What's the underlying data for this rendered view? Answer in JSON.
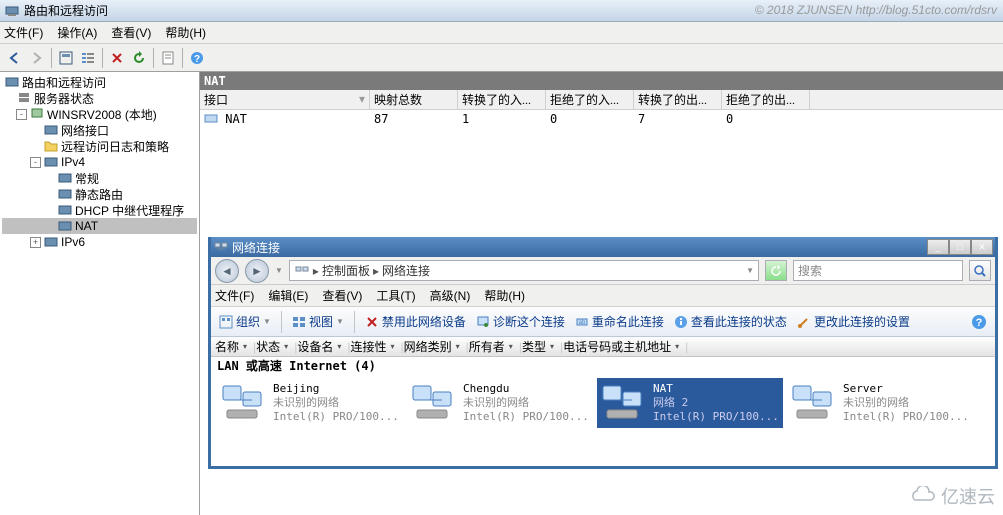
{
  "title_bar": {
    "title": "路由和远程访问"
  },
  "watermark": "© 2018 ZJUNSEN http://blog.51cto.com/rdsrv",
  "menu": {
    "file": "文件(F)",
    "action": "操作(A)",
    "view": "查看(V)",
    "help": "帮助(H)"
  },
  "tree": {
    "root": "路由和远程访问",
    "server_status": "服务器状态",
    "winsrv": "WINSRV2008 (本地)",
    "net_if": "网络接口",
    "remote_log": "远程访问日志和策略",
    "ipv4": "IPv4",
    "general": "常规",
    "static_route": "静态路由",
    "dhcp": "DHCP 中继代理程序",
    "nat": "NAT",
    "ipv6": "IPv6"
  },
  "content": {
    "header": "NAT",
    "columns": [
      "接口",
      "映射总数",
      "转换了的入...",
      "拒绝了的入...",
      "转换了的出...",
      "拒绝了的出..."
    ],
    "row": {
      "name": "NAT",
      "c1": "87",
      "c2": "1",
      "c3": "0",
      "c4": "7",
      "c5": "0"
    }
  },
  "subwin": {
    "title": "网络连接",
    "nav": {
      "seg1": "控制面板",
      "seg2": "网络连接"
    },
    "search_placeholder": "搜索",
    "menu": {
      "file": "文件(F)",
      "edit": "编辑(E)",
      "view": "查看(V)",
      "tool": "工具(T)",
      "adv": "高级(N)",
      "help": "帮助(H)"
    },
    "toolbar": {
      "org": "组织",
      "views": "视图",
      "disable": "禁用此网络设备",
      "diag": "诊断这个连接",
      "rename": "重命名此连接",
      "status": "查看此连接的状态",
      "change": "更改此连接的设置"
    },
    "columns": [
      "名称",
      "状态",
      "设备名",
      "连接性",
      "网络类别",
      "所有者",
      "类型",
      "电话号码或主机地址"
    ],
    "group": "LAN 或高速 Internet (4)",
    "items": [
      {
        "name": "Beijing",
        "status": "未识别的网络",
        "driver": "Intel(R) PRO/100..."
      },
      {
        "name": "Chengdu",
        "status": "未识别的网络",
        "driver": "Intel(R) PRO/100..."
      },
      {
        "name": "NAT",
        "status": "网络  2",
        "driver": "Intel(R) PRO/100..."
      },
      {
        "name": "Server",
        "status": "未识别的网络",
        "driver": "Intel(R) PRO/100..."
      }
    ]
  },
  "logo": "亿速云"
}
